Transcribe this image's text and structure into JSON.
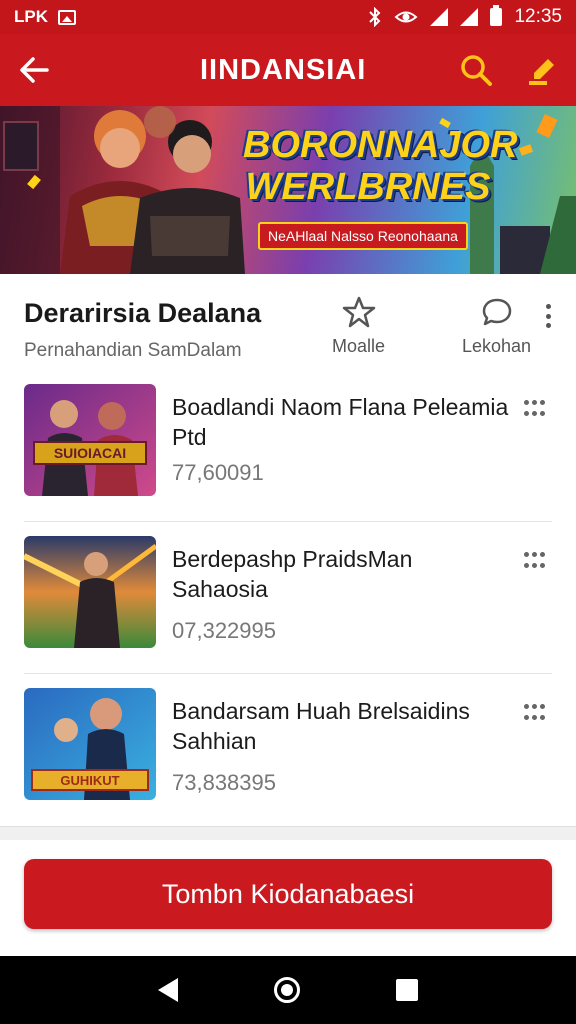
{
  "status_bar": {
    "left_label": "LPK",
    "time": "12:35",
    "icons": [
      "image-icon",
      "bluetooth-icon",
      "eye-icon",
      "signal-icon",
      "signal-icon",
      "battery-icon"
    ]
  },
  "app_bar": {
    "title": "IINDANSIAI",
    "back_icon": "arrow-left-icon",
    "actions": [
      "search-icon",
      "edit-icon"
    ]
  },
  "banner": {
    "title_line1": "BORONNAJOR",
    "title_line2": "WERLBRNES",
    "tag": "NeAHlaal Nalsso Reonohaana"
  },
  "section": {
    "title": "Derarirsia Dealana",
    "subtitle": "Pernahandian  SamDalam",
    "actions": [
      {
        "icon": "star-icon",
        "label": "Moalle"
      },
      {
        "icon": "comment-icon",
        "label": "Lekohan"
      }
    ]
  },
  "items": [
    {
      "title": "Boadlandi Naom Flana Peleamia Ptd",
      "meta": "77,60091",
      "thumb_caption": "SUIOIACAI"
    },
    {
      "title": "Berdepashp PraidsMan Sahaosia",
      "meta": "07,322995",
      "thumb_caption": ""
    },
    {
      "title": "Bandarsam Huah Brelsaidins Sahhian",
      "meta": "73,838395",
      "thumb_caption": "GUHIKUT"
    }
  ],
  "cta": {
    "label": "Tombn Kiodanabaesi"
  },
  "colors": {
    "primary": "#c9181e",
    "status": "#c2161b",
    "accent": "#ffd21a"
  }
}
